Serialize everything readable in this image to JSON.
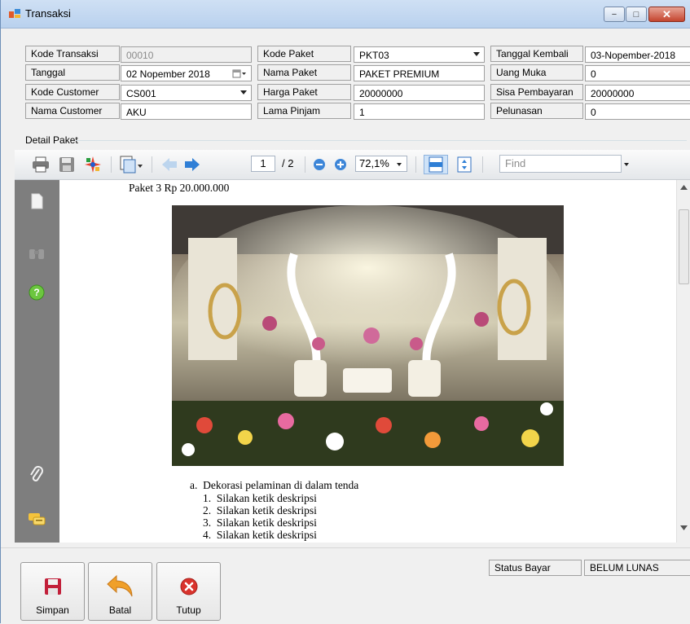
{
  "window": {
    "title": "Transaksi",
    "min_glyph": "−",
    "max_glyph": "□",
    "close_glyph": "✕"
  },
  "form": {
    "kode_transaksi": {
      "label": "Kode Transaksi",
      "value": "00010"
    },
    "tanggal": {
      "label": "Tanggal",
      "value": "02 Nopember 2018"
    },
    "kode_customer": {
      "label": "Kode Customer",
      "value": "CS001"
    },
    "nama_customer": {
      "label": "Nama Customer",
      "value": "AKU"
    },
    "kode_paket": {
      "label": "Kode Paket",
      "value": "PKT03"
    },
    "nama_paket": {
      "label": "Nama Paket",
      "value": "PAKET PREMIUM"
    },
    "harga_paket": {
      "label": "Harga Paket",
      "value": "20000000"
    },
    "lama_pinjam": {
      "label": "Lama Pinjam",
      "value": "1"
    },
    "tanggal_kembali": {
      "label": "Tanggal Kembali",
      "value": "03-Nopember-2018"
    },
    "uang_muka": {
      "label": "Uang Muka",
      "value": "0"
    },
    "sisa_pembayaran": {
      "label": "Sisa Pembayaran",
      "value": "20000000"
    },
    "pelunasan": {
      "label": "Pelunasan",
      "value": "0"
    }
  },
  "detail_group_label": "Detail Paket",
  "report_toolbar": {
    "current_page": "1",
    "page_count": "/ 2",
    "zoom": "72,1%",
    "find_placeholder": "Find"
  },
  "document": {
    "heading": "Paket 3 Rp 20.000.000",
    "item_a": "a.  Dekorasi pelaminan di dalam tenda",
    "subitems": [
      "1.  Silakan ketik deskripsi",
      "2.  Silakan ketik deskripsi",
      "3.  Silakan ketik deskripsi",
      "4.  Silakan ketik deskripsi"
    ]
  },
  "status": {
    "label": "Status Bayar",
    "value": "BELUM LUNAS"
  },
  "buttons": {
    "simpan": "Simpan",
    "batal": "Batal",
    "tutup": "Tutup"
  },
  "colors": {
    "title_gradient": "#c8dcf2",
    "close_red": "#c4452f",
    "sidebar_grey": "#7e7e7e",
    "accent_blue": "#2f7fd6"
  }
}
